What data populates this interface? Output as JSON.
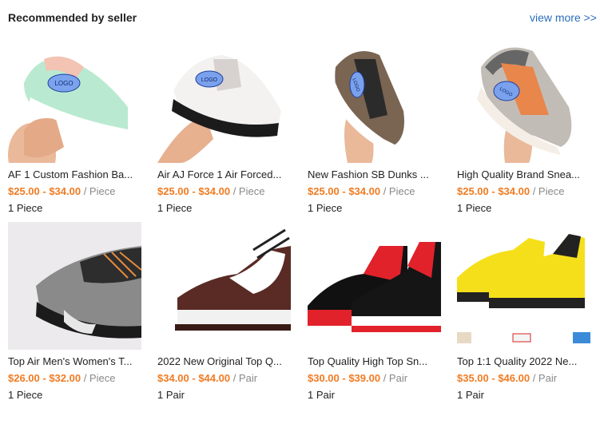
{
  "header": {
    "title": "Recommended by seller",
    "more": "view more >>"
  },
  "products": [
    {
      "name": "AF 1 Custom Fashion Ba...",
      "price": "$25.00 - $34.00",
      "unit": "/ Piece",
      "moq": "1 Piece",
      "logo": "LOGO"
    },
    {
      "name": "Air AJ Force 1 Air Forced...",
      "price": "$25.00 - $34.00",
      "unit": "/ Piece",
      "moq": "1 Piece",
      "logo": "LOGO"
    },
    {
      "name": "New Fashion SB Dunks ...",
      "price": "$25.00 - $34.00",
      "unit": "/ Piece",
      "moq": "1 Piece",
      "logo": "LOGO"
    },
    {
      "name": "High Quality Brand Snea...",
      "price": "$25.00 - $34.00",
      "unit": "/ Piece",
      "moq": "1 Piece",
      "logo": "LOGO"
    },
    {
      "name": "Top Air Men's Women's T...",
      "price": "$26.00 - $32.00",
      "unit": "/ Piece",
      "moq": "1 Piece"
    },
    {
      "name": "2022 New Original Top Q...",
      "price": "$34.00 - $44.00",
      "unit": "/ Pair",
      "moq": "1 Pair"
    },
    {
      "name": "Top Quality High Top Sn...",
      "price": "$30.00 - $39.00",
      "unit": "/ Pair",
      "moq": "1 Pair"
    },
    {
      "name": "Top 1:1 Quality 2022 Ne...",
      "price": "$35.00 - $46.00",
      "unit": "/ Pair",
      "moq": "1 Pair"
    }
  ]
}
